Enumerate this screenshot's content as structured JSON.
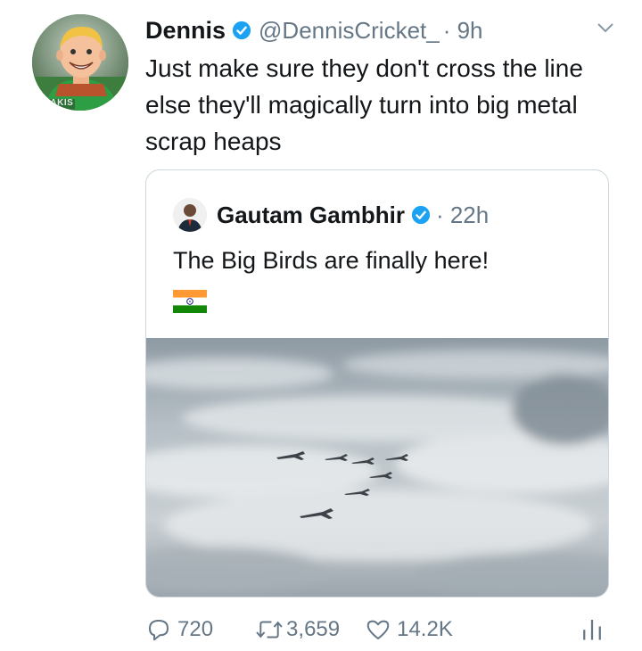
{
  "tweet": {
    "display_name": "Dennis",
    "handle": "@DennisCricket_",
    "time": "· 9h",
    "text": "Just make sure they don't cross the line else they'll magically turn into big metal scrap heaps",
    "avatar_badge": "PAKIS"
  },
  "quoted_tweet": {
    "display_name": "Gautam Gambhir",
    "time": "· 22h",
    "text": "The Big Birds are finally here!",
    "flag_icon": "india-flag-icon"
  },
  "actions": {
    "replies": "720",
    "retweets": "3,659",
    "likes": "14.2K"
  },
  "colors": {
    "text": "#14171a",
    "secondary": "#657786",
    "verified": "#1da1f2",
    "border": "#ccd6dd"
  }
}
